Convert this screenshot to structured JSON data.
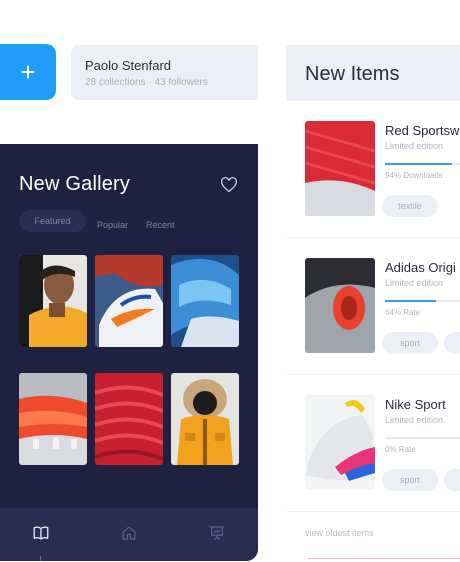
{
  "actions": {
    "add_label": "+"
  },
  "profile": {
    "name": "Paolo Stenfard",
    "subtitle": "28 collections · 43 followers"
  },
  "gallery": {
    "title": "New Gallery",
    "tabs": [
      "Featured",
      "Popular",
      "Recent"
    ],
    "tiles": [
      {
        "icon": "athlete-photo"
      },
      {
        "icon": "sneaker-photo"
      },
      {
        "icon": "blue-shoe-photo"
      },
      {
        "icon": "orange-sole-photo"
      },
      {
        "icon": "red-knit-photo"
      },
      {
        "icon": "yellow-jacket-photo"
      }
    ],
    "nav": [
      {
        "icon": "book-icon"
      },
      {
        "icon": "home-icon"
      },
      {
        "icon": "presentation-icon"
      }
    ]
  },
  "new_items": {
    "title": "New Items",
    "items": [
      {
        "name": "Red Sportsw",
        "sub": "Limited edition",
        "progress": 0.84,
        "stat": "94% Downloads",
        "tags": [
          "textile"
        ]
      },
      {
        "name": "Adidas Origi",
        "sub": "Limited edition",
        "progress": 0.64,
        "stat": "64% Rate",
        "tags": [
          "sport",
          ""
        ]
      },
      {
        "name": "Nike Sport",
        "sub": "Limited edition",
        "progress": 0.0,
        "stat": "0% Rate",
        "tags": [
          "sport",
          ""
        ]
      }
    ],
    "view_oldest": "view oldest items"
  },
  "colors": {
    "accent": "#1e9cf8",
    "panel_dark": "#1f2140",
    "card_bg": "#eceff6"
  }
}
